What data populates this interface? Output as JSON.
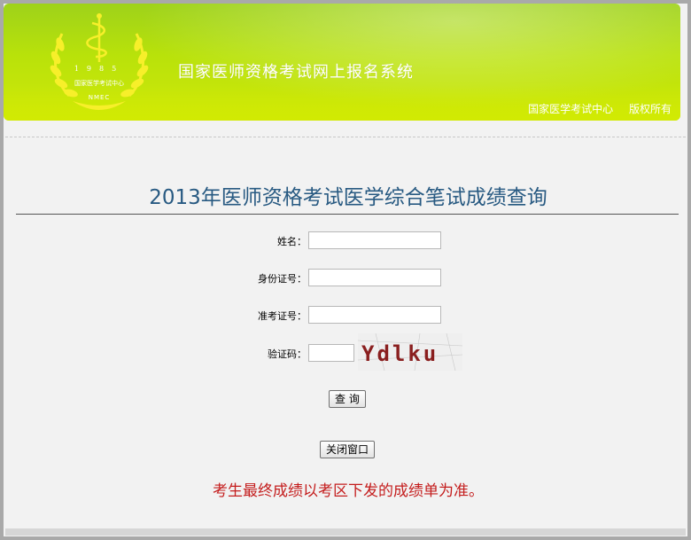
{
  "header": {
    "site_title": "国家医师资格考试网上报名系统",
    "logo_year": "1985",
    "logo_org": "国家医学考试中心",
    "logo_abbr": "NMEC",
    "links": [
      "国家医学考试中心",
      "版权所有"
    ]
  },
  "page": {
    "title": "2013年医师资格考试医学综合笔试成绩查询"
  },
  "form": {
    "name_label": "姓名：",
    "name_value": "",
    "id_label": "身份证号：",
    "id_value": "",
    "ticket_label": "准考证号：",
    "ticket_value": "",
    "captcha_label": "验证码：",
    "captcha_value": "",
    "captcha_text": "Ydlku",
    "query_button": "查 询",
    "close_button": "关闭窗口"
  },
  "notice": "考生最终成绩以考区下发的成绩单为准。",
  "colors": {
    "header_green": "#b9e20a",
    "title_blue": "#285a82",
    "notice_red": "#c41d1d"
  }
}
